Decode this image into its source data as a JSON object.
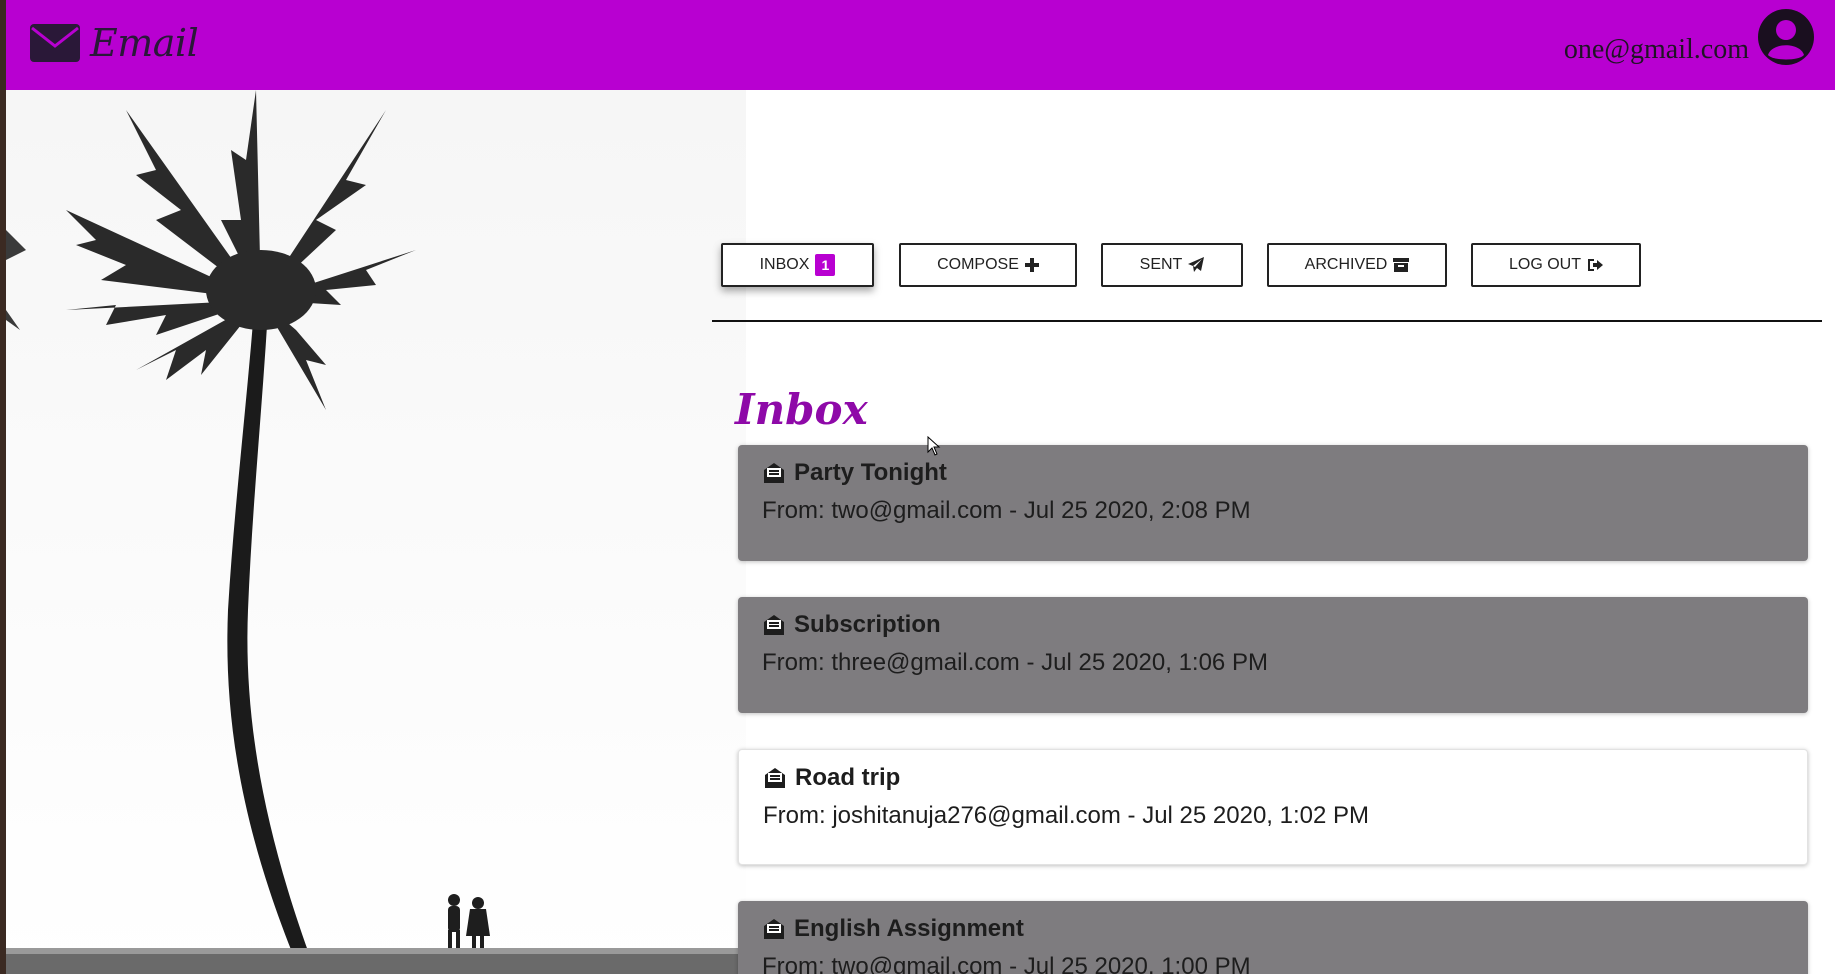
{
  "header": {
    "brand": "Email",
    "brand_icon": "envelope-icon",
    "user_email": "one@gmail.com",
    "avatar_icon": "user-circle-icon",
    "background_color": "#b800d1"
  },
  "nav": {
    "inbox_label": "INBOX",
    "inbox_count": "1",
    "compose_label": "COMPOSE",
    "sent_label": "SENT",
    "archived_label": "ARCHIVED",
    "logout_label": "LOG OUT"
  },
  "main": {
    "heading": "Inbox",
    "emails": [
      {
        "subject": "Party Tonight",
        "from_label": "From:",
        "sender": "two@gmail.com",
        "separator": "-",
        "timestamp": "Jul 25 2020, 2:08 PM",
        "read": true
      },
      {
        "subject": "Subscription",
        "from_label": "From:",
        "sender": "three@gmail.com",
        "separator": "-",
        "timestamp": "Jul 25 2020, 1:06 PM",
        "read": true
      },
      {
        "subject": "Road trip",
        "from_label": "From:",
        "sender": "joshitanuja276@gmail.com",
        "separator": "-",
        "timestamp": "Jul 25 2020, 1:02 PM",
        "read": false
      },
      {
        "subject": "English Assignment",
        "from_label": "From:",
        "sender": "two@gmail.com",
        "separator": "-",
        "timestamp": "Jul 25 2020, 1:00 PM",
        "read": true
      }
    ]
  },
  "colors": {
    "accent": "#b800d1",
    "heading": "#8e09a8",
    "read_card": "#7e7c7f",
    "unread_card": "#ffffff"
  }
}
